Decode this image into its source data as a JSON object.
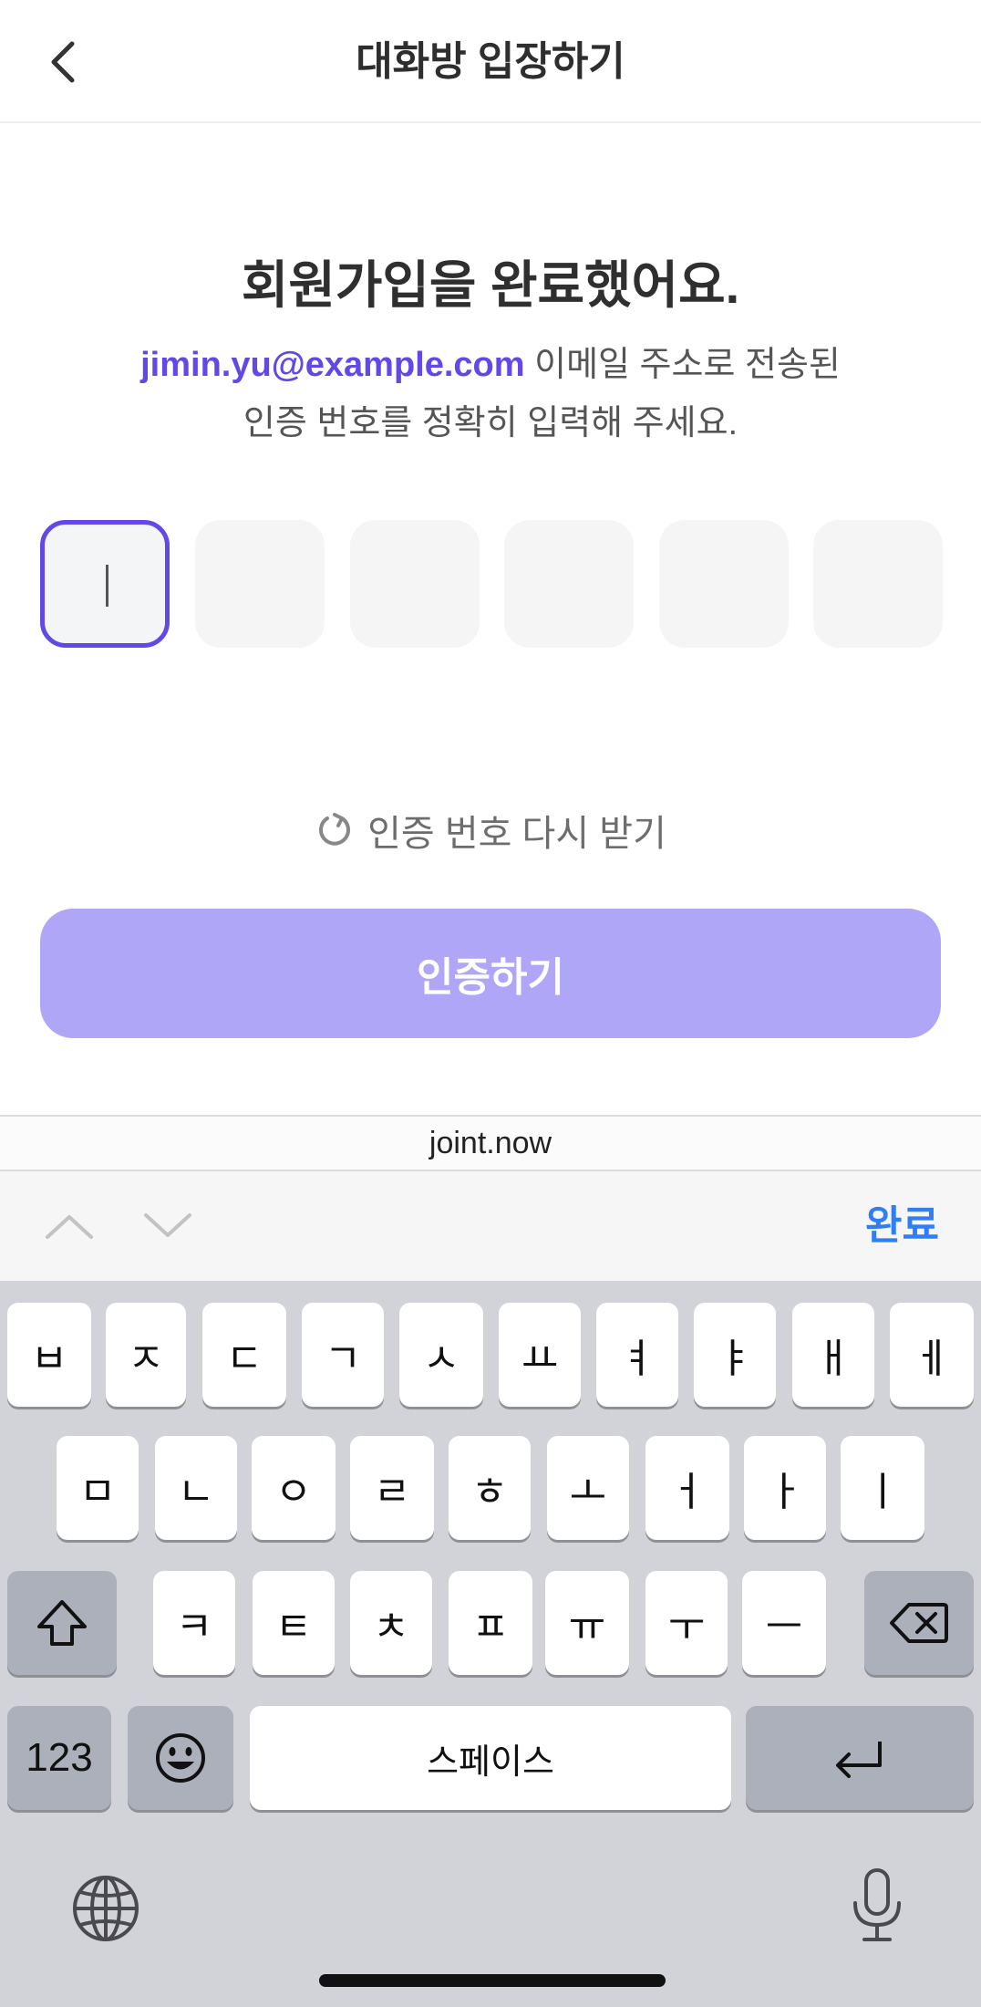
{
  "header": {
    "title": "대화방 입장하기",
    "back_icon": "chevron-left-icon"
  },
  "main": {
    "headline": "회원가입을 완료했어요.",
    "email": "jimin.yu@example.com",
    "subtitle_after_email": " 이메일 주소로 전송된",
    "subtitle_line2": "인증 번호를 정확히 입력해 주세요.",
    "otp_digits": [
      "",
      "",
      "",
      "",
      "",
      ""
    ],
    "resend_label": "인증 번호 다시 받기",
    "resend_icon": "refresh-icon",
    "verify_label": "인증하기"
  },
  "browser": {
    "url": "joint.now"
  },
  "accessory": {
    "prev_icon": "chevron-up-icon",
    "next_icon": "chevron-down-icon",
    "done_label": "완료"
  },
  "keyboard": {
    "row1": [
      "ㅂ",
      "ㅈ",
      "ㄷ",
      "ㄱ",
      "ㅅ",
      "ㅛ",
      "ㅕ",
      "ㅑ",
      "ㅐ",
      "ㅔ"
    ],
    "row2": [
      "ㅁ",
      "ㄴ",
      "ㅇ",
      "ㄹ",
      "ㅎ",
      "ㅗ",
      "ㅓ",
      "ㅏ",
      "ㅣ"
    ],
    "row3": [
      "ㅋ",
      "ㅌ",
      "ㅊ",
      "ㅍ",
      "ㅠ",
      "ㅜ",
      "ㅡ"
    ],
    "numbers_label": "123",
    "space_label": "스페이스",
    "shift_icon": "shift-icon",
    "delete_icon": "backspace-icon",
    "emoji_icon": "emoji-icon",
    "return_icon": "return-icon",
    "globe_icon": "globe-icon",
    "mic_icon": "microphone-icon"
  },
  "colors": {
    "accent": "#6249e6",
    "button_disabled": "#b0a6f7",
    "link_blue": "#2f7ef6",
    "keyboard_bg": "#d2d3d8"
  }
}
